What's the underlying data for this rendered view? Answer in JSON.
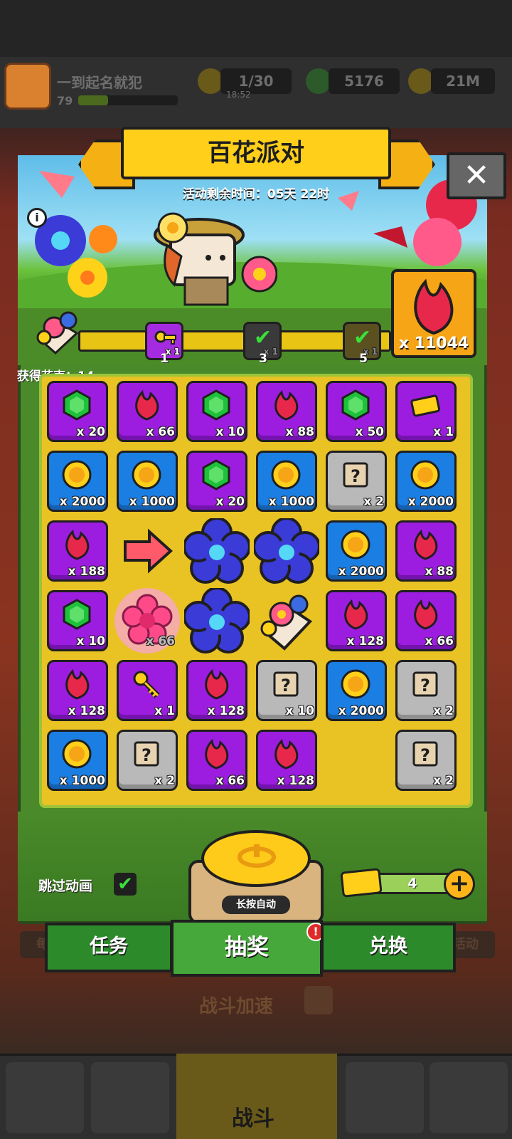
{
  "header": {
    "player_name": "一到起名就犯",
    "level": "79",
    "energy": "1/30",
    "energy_timer": "18:52",
    "gems": "5176",
    "gold": "21M"
  },
  "event": {
    "title": "百花派对",
    "remaining_label": "活动剩余时间：05天 22时",
    "close_symbol": "✕",
    "info_symbol": "i",
    "petal_count": "x 11044",
    "bouquets_label": "获得花束：14",
    "milestones": [
      {
        "label": "1",
        "reward_count": "x 1",
        "state": "available"
      },
      {
        "label": "3",
        "reward_count": "x 1",
        "state": "claimed"
      },
      {
        "label": "5",
        "reward_count": "x 1",
        "state": "claimed"
      }
    ]
  },
  "board": {
    "rows": [
      [
        {
          "type": "gem",
          "count": "x 20"
        },
        {
          "type": "petal",
          "count": "x 66"
        },
        {
          "type": "gem",
          "count": "x 10"
        },
        {
          "type": "petal",
          "count": "x 88"
        },
        {
          "type": "gem",
          "count": "x 50"
        },
        {
          "type": "ticket",
          "count": "x 1"
        }
      ],
      [
        {
          "type": "coin",
          "count": "x 2000"
        },
        {
          "type": "coin",
          "count": "x 1000"
        },
        {
          "type": "gem",
          "count": "x 20"
        },
        {
          "type": "coin",
          "count": "x 1000"
        },
        {
          "type": "scroll",
          "count": "x 2"
        },
        {
          "type": "coin",
          "count": "x 2000"
        }
      ],
      [
        {
          "type": "petal",
          "count": "x 188"
        },
        {
          "type": "arrow",
          "count": ""
        },
        {
          "type": "blue-flower",
          "count": ""
        },
        {
          "type": "blue-flower",
          "count": ""
        },
        {
          "type": "coin",
          "count": "x 2000"
        },
        {
          "type": "petal",
          "count": "x 88"
        }
      ],
      [
        {
          "type": "gem",
          "count": "x 10"
        },
        {
          "type": "pink-flower",
          "count": "x 66"
        },
        {
          "type": "blue-flower",
          "count": ""
        },
        {
          "type": "bouquet",
          "count": ""
        },
        {
          "type": "petal",
          "count": "x 128"
        },
        {
          "type": "petal",
          "count": "x 66"
        }
      ],
      [
        {
          "type": "petal",
          "count": "x 128"
        },
        {
          "type": "key",
          "count": "x 1"
        },
        {
          "type": "petal",
          "count": "x 128"
        },
        {
          "type": "scroll",
          "count": "x 10"
        },
        {
          "type": "coin",
          "count": "x 2000"
        },
        {
          "type": "scroll",
          "count": "x 2"
        }
      ],
      [
        {
          "type": "coin",
          "count": "x 1000"
        },
        {
          "type": "scroll",
          "count": "x 2"
        },
        {
          "type": "petal",
          "count": "x 66"
        },
        {
          "type": "petal",
          "count": "x 128"
        },
        {
          "type": "empty",
          "count": ""
        },
        {
          "type": "scroll",
          "count": "x 2"
        }
      ]
    ]
  },
  "controls": {
    "skip_animation_label": "跳过动画",
    "skip_checked_symbol": "✔",
    "auto_label": "长按自动",
    "tickets": "4",
    "plus_symbol": "+"
  },
  "tabs": [
    {
      "label": "任务",
      "active": false
    },
    {
      "label": "抽奖",
      "active": true,
      "badge": "!"
    },
    {
      "label": "兑换",
      "active": false
    }
  ],
  "background": {
    "speed_label": "战斗加速",
    "nav_battle_label": "战斗",
    "left_side_label": "每日",
    "right_side_label": "活动"
  },
  "colors": {
    "purple_tile": "#9c1de0",
    "blue_tile": "#1b7ee3",
    "gray_tile": "#b9b9b9",
    "board_yellow": "#e9c224",
    "title_yellow": "#ffcf1a",
    "petal_red": "#e8284a"
  }
}
